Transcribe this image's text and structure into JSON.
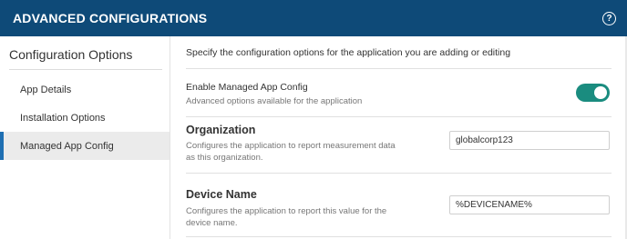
{
  "header": {
    "title": "ADVANCED CONFIGURATIONS",
    "help_glyph": "?"
  },
  "sidebar": {
    "title": "Configuration Options",
    "items": [
      {
        "label": "App Details",
        "active": false
      },
      {
        "label": "Installation Options",
        "active": false
      },
      {
        "label": "Managed App Config",
        "active": true
      }
    ]
  },
  "main": {
    "intro": "Specify the configuration options for the application you are adding or editing",
    "enable": {
      "label": "Enable Managed App Config",
      "description": "Advanced options available for the application",
      "enabled": true
    },
    "organization": {
      "title": "Organization",
      "description": "Configures the application to report measurement data as this organization.",
      "value": "globalcorp123"
    },
    "device_name": {
      "title": "Device Name",
      "description": "Configures the application to report this value for the device name.",
      "value": "%DEVICENAME%"
    }
  },
  "colors": {
    "header_bg": "#0e4a78",
    "toggle_on": "#1a8c7f",
    "active_indicator": "#1f6fb2"
  }
}
